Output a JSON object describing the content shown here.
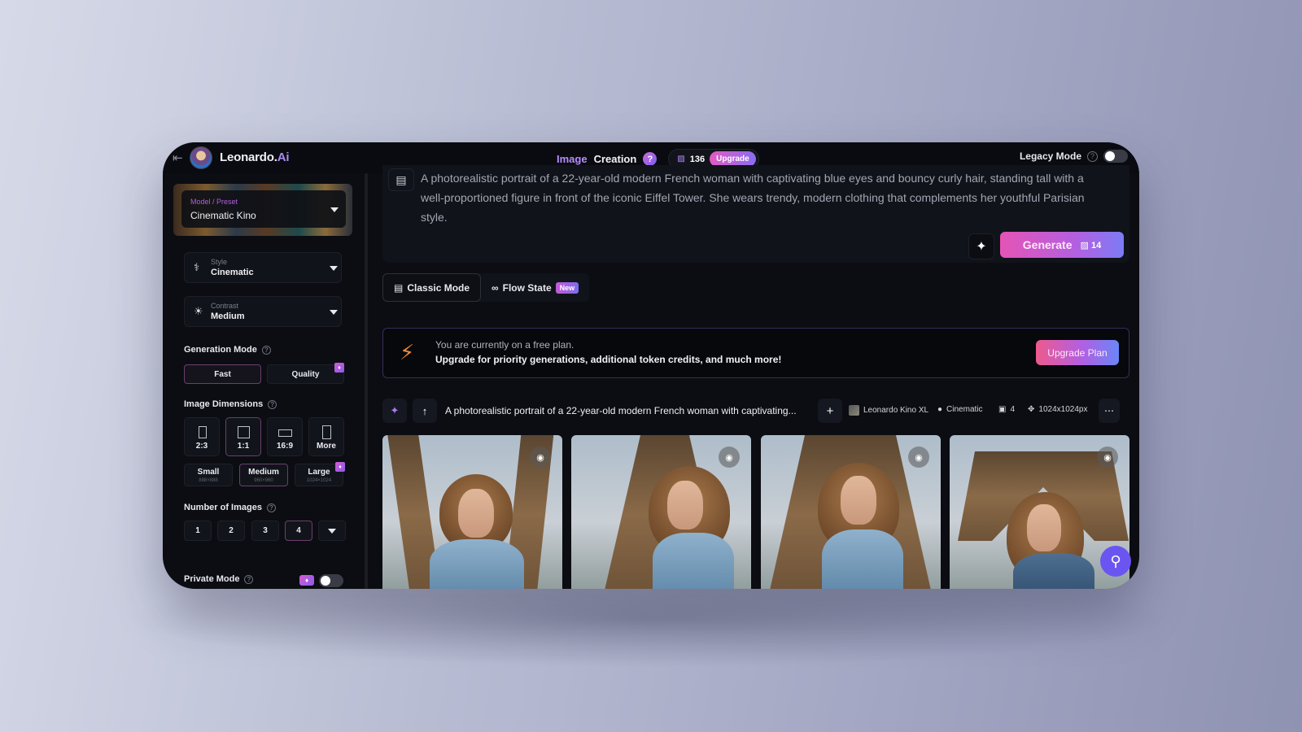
{
  "header": {
    "back_icon": "arrow-left-icon",
    "brand": "Leonardo.",
    "brand_suffix": "Ai",
    "title_part1": "Image",
    "title_part2": "Creation",
    "help": "?",
    "credits": "136",
    "upgrade": "Upgrade",
    "legacy_mode_label": "Legacy Mode",
    "legacy_mode_on": false
  },
  "sidebar": {
    "preset": {
      "label": "Model / Preset",
      "value": "Cinematic Kino"
    },
    "style": {
      "label": "Style",
      "value": "Cinematic"
    },
    "contrast": {
      "label": "Contrast",
      "value": "Medium"
    },
    "generation_mode": {
      "label": "Generation Mode",
      "options": [
        "Fast",
        "Quality"
      ],
      "selected": "Fast"
    },
    "image_dimensions": {
      "label": "Image Dimensions",
      "ratios": [
        "2:3",
        "1:1",
        "16:9",
        "More"
      ],
      "selected_ratio": "1:1",
      "sizes": [
        {
          "label": "Small",
          "sub": "888×888"
        },
        {
          "label": "Medium",
          "sub": "960×960"
        },
        {
          "label": "Large",
          "sub": "1024×1024"
        }
      ],
      "selected_size": "Medium"
    },
    "number_of_images": {
      "label": "Number of Images",
      "options": [
        "1",
        "2",
        "3",
        "4"
      ],
      "selected": "4"
    },
    "private_mode": {
      "label": "Private Mode",
      "on": false
    }
  },
  "prompt": {
    "text": "A photorealistic portrait of a 22-year-old modern French woman with captivating blue eyes and bouncy curly hair, standing tall with a well-proportioned figure in front of the iconic Eiffel Tower. She wears trendy, modern clothing that complements her youthful Parisian style.",
    "generate_label": "Generate",
    "generate_cost": "14"
  },
  "modes": {
    "classic": "Classic Mode",
    "flow": "Flow State",
    "flow_badge": "New"
  },
  "banner": {
    "line1": "You are currently on a free plan.",
    "line2": "Upgrade for priority generations, additional token credits, and much more!",
    "button": "Upgrade Plan"
  },
  "generation": {
    "prompt_truncated": "A photorealistic portrait of a 22-year-old modern French woman with captivating...",
    "model": "Leonardo Kino XL",
    "style": "Cinematic",
    "count": "4",
    "dimensions": "1024x1024px",
    "images": [
      {
        "alt": "Woman with curly hair in denim jacket in front of Eiffel Tower 1"
      },
      {
        "alt": "Woman with curly hair in denim jacket in front of Eiffel Tower 2"
      },
      {
        "alt": "Woman with curly hair in denim jacket in front of Eiffel Tower 3"
      },
      {
        "alt": "Woman with curly hair in denim jacket in front of Eiffel Tower 4"
      }
    ]
  },
  "colors": {
    "accent_purple": "#b58cff",
    "accent_pink": "#e454b5",
    "accent_blue": "#7c7cf5",
    "bolt_orange": "#f08a3a"
  }
}
